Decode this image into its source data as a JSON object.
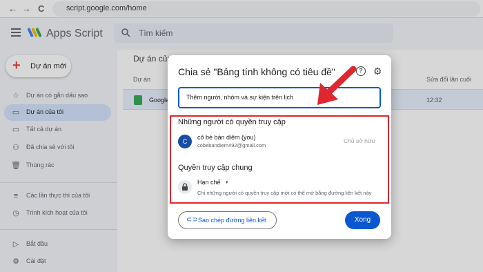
{
  "browser": {
    "back": "←",
    "forward": "→",
    "reload": "C",
    "url": "script.google.com/home"
  },
  "app": {
    "title": "Apps Script",
    "search_placeholder": "Tìm kiếm",
    "new_project": "Dự án mới"
  },
  "sidebar": {
    "items": [
      {
        "label": "Dự án có gắn dấu sao",
        "icon": "star-icon"
      },
      {
        "label": "Dự án của tôi",
        "icon": "folder-icon"
      },
      {
        "label": "Tất cả dự án",
        "icon": "folder-icon"
      },
      {
        "label": "Đã chia sẻ với tôi",
        "icon": "people-icon"
      },
      {
        "label": "Thùng rác",
        "icon": "trash-icon"
      },
      {
        "label": "Các lần thực thi của tôi",
        "icon": "executions-icon"
      },
      {
        "label": "Trình kích hoạt của tôi",
        "icon": "clock-icon"
      },
      {
        "label": "Bắt đầu",
        "icon": "play-icon"
      },
      {
        "label": "Cài đặt",
        "icon": "settings-icon"
      }
    ]
  },
  "main": {
    "heading": "Dự án của tôi",
    "columns": {
      "project": "Dự án",
      "modified": "Sửa đổi lần cuối"
    },
    "row": {
      "name": "Google",
      "time": "12:32"
    }
  },
  "dialog": {
    "title": "Chia sẻ \"Bảng tính không có tiêu đề\"",
    "help": "?",
    "input_placeholder": "Thêm người, nhóm và sự kiện trên lịch",
    "people_section": "Những người có quyền truy cập",
    "user": {
      "initial": "C",
      "name": "cô bé bán diêm (you)",
      "email": "cobebandiem492@gmail.com",
      "role": "Chủ sở hữu"
    },
    "general_section": "Quyền truy cập chung",
    "access": {
      "level": "Hạn chế",
      "caret": "▾",
      "description": "Chỉ những người có quyền truy cập mới có thể mở bằng đường liên kết này"
    },
    "copy_link": "Sao chép đường liên kết",
    "done": "Xong"
  },
  "colors": {
    "primary": "#0b57d0",
    "highlight": "#e0262e",
    "active_nav": "#d3e3fd"
  }
}
